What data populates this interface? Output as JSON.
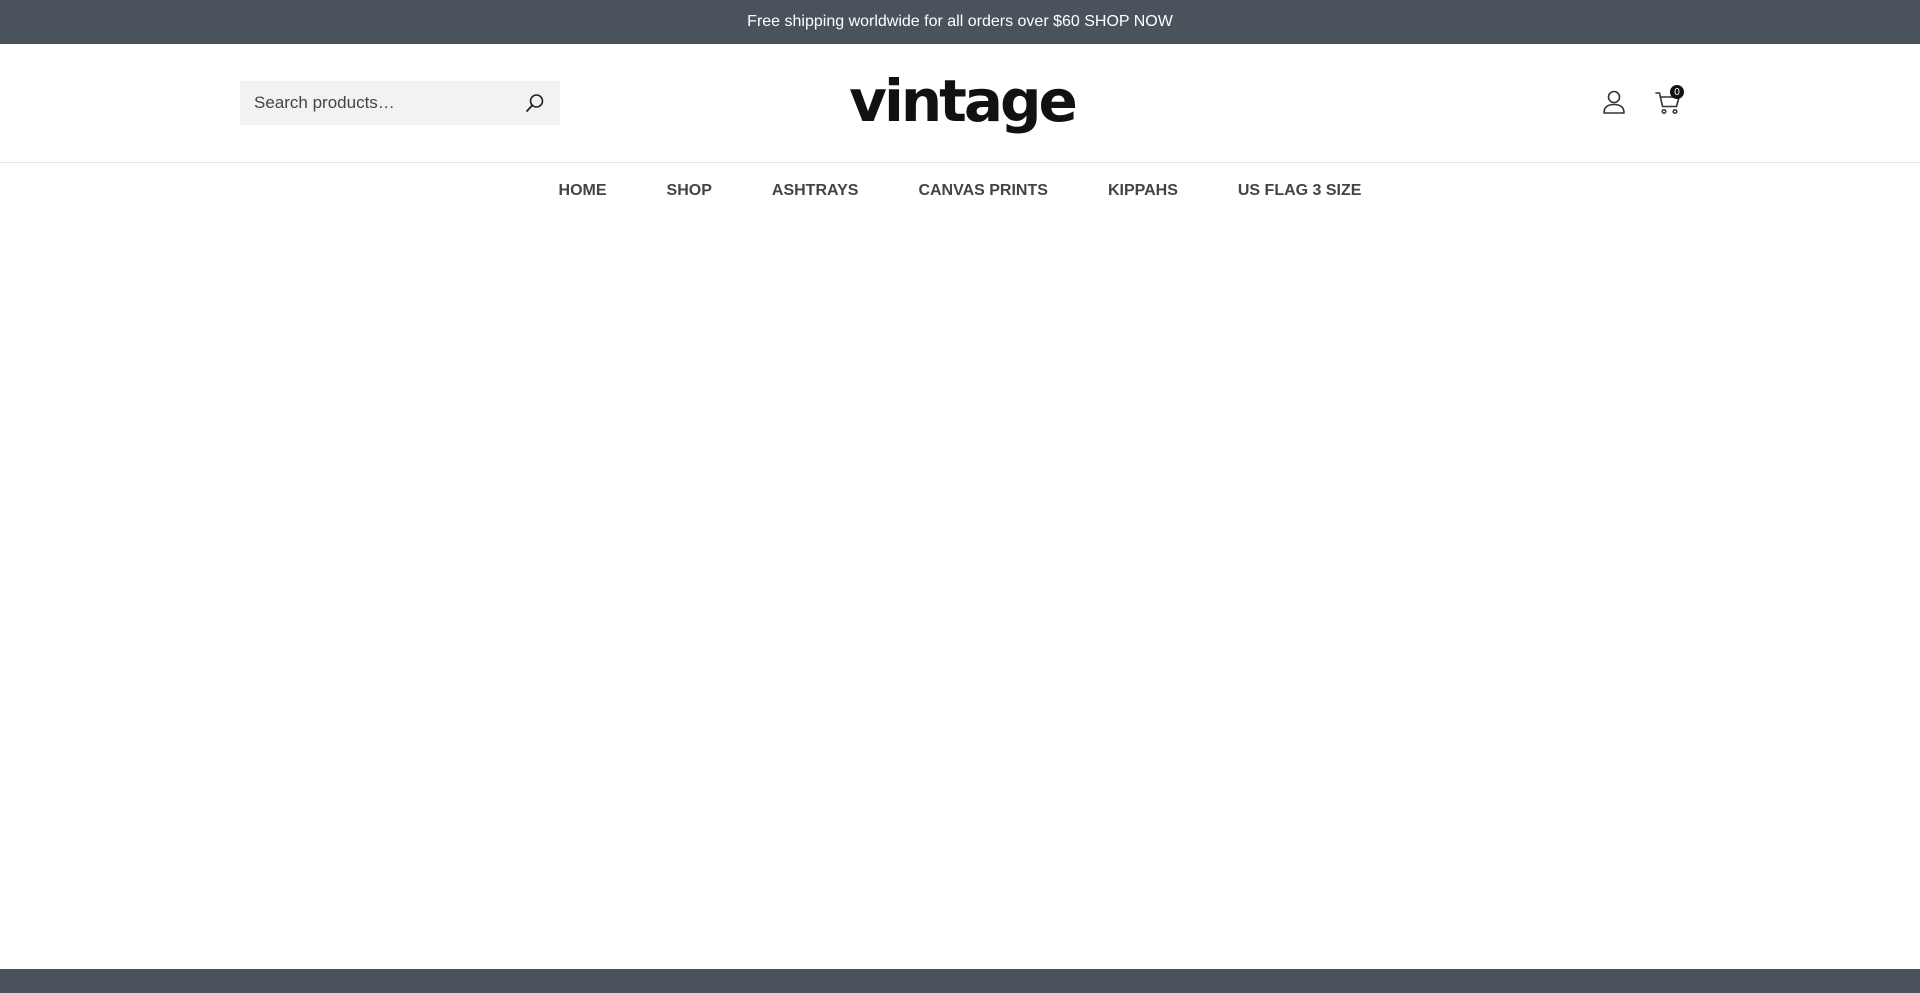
{
  "announcement": {
    "text": "Free shipping worldwide for all orders over $60 SHOP NOW"
  },
  "search": {
    "placeholder": "Search products…",
    "value": ""
  },
  "logo": {
    "text": "vintage"
  },
  "cart": {
    "count": "0"
  },
  "nav": {
    "items": [
      {
        "label": "HOME"
      },
      {
        "label": "SHOP"
      },
      {
        "label": "ASHTRAYS"
      },
      {
        "label": "CANVAS PRINTS"
      },
      {
        "label": "KIPPAHS"
      },
      {
        "label": "US FLAG 3 SIZE"
      }
    ]
  },
  "icons": {
    "search": "search-icon",
    "account": "user-icon",
    "cart": "cart-icon"
  },
  "colors": {
    "topbar": "#4a525b",
    "text": "#444444",
    "search_bg": "#f2f2f2"
  }
}
